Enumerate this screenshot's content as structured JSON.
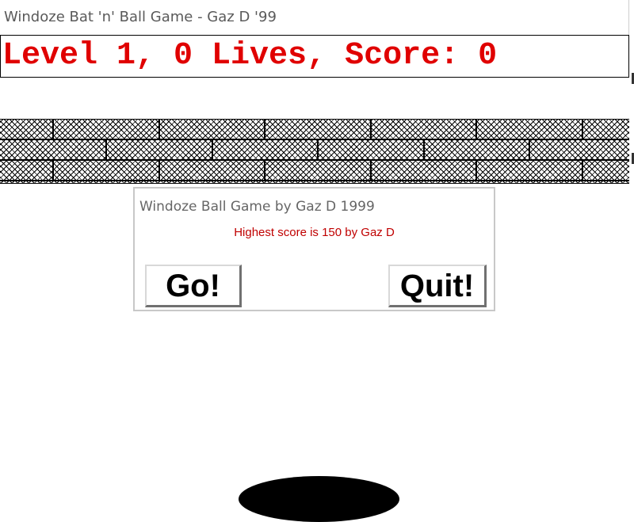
{
  "window": {
    "title": "Windoze Bat 'n' Ball Game - Gaz D '99"
  },
  "status": {
    "text": "Level 1, 0 Lives, Score: 0",
    "color": "#e00000"
  },
  "dialog": {
    "title": "Windoze Ball Game by Gaz D 1999",
    "message": "Highest score is 150 by Gaz D",
    "message_color": "#c00000",
    "go_label": "Go!",
    "quit_label": "Quit!"
  },
  "game": {
    "brick_rows": 3
  }
}
